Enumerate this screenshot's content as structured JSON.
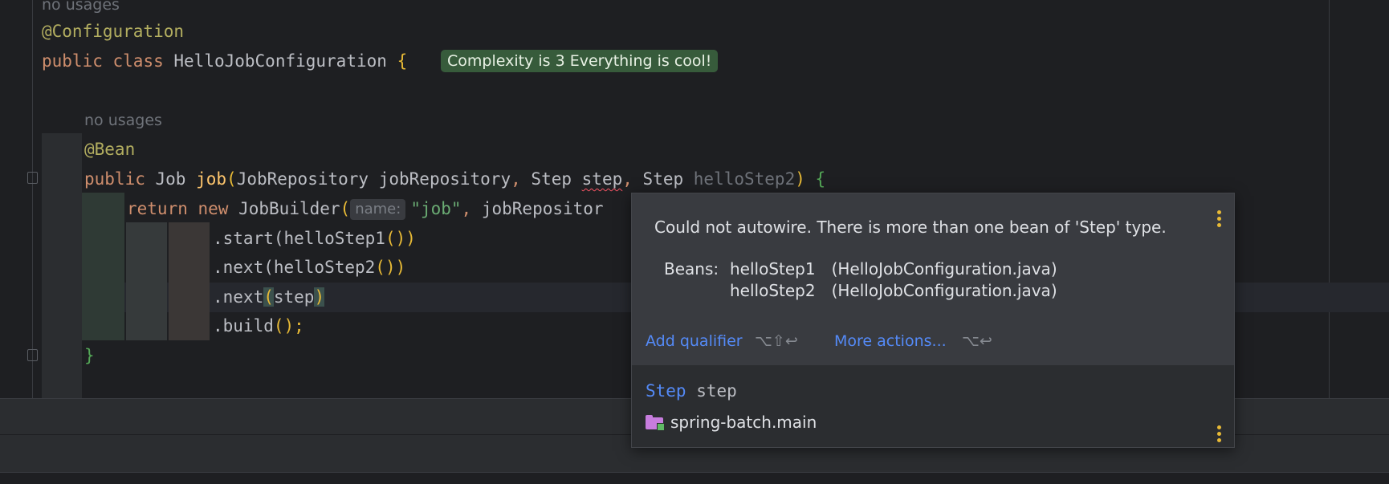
{
  "editor": {
    "lines": {
      "usage_top": "no usages",
      "annotation_config": "@Configuration",
      "class_kw1": "public",
      "class_kw2": "class",
      "class_name": "HelloJobConfiguration",
      "class_brace": "{",
      "usage_method": "no usages",
      "annotation_bean": "@Bean",
      "m_public": "public",
      "m_type": "Job",
      "m_name": "job",
      "m_paren_open": "(",
      "m_p1_type": "JobRepository",
      "m_p1_name": "jobRepository",
      "m_comma1": ",",
      "m_p2_type": "Step",
      "m_p2_name": "step",
      "m_comma2": ",",
      "m_p3_type": "Step",
      "m_p3_name": "helloStep2",
      "m_paren_close": ")",
      "m_brace": "{",
      "r_return": "return",
      "r_new": "new",
      "r_builder": "JobBuilder",
      "r_paren": "(",
      "r_hint": "name:",
      "r_str": "\"job\"",
      "r_comma": ",",
      "r_repo": "jobRepositor",
      "c_start": ".start(",
      "c_start_arg": "helloStep1",
      "c_start_tail": "())",
      "c_next1": ".next(",
      "c_next1_arg": "helloStep2",
      "c_next1_tail": "())",
      "c_next2": ".next",
      "c_next2_open": "(",
      "c_next2_arg": "step",
      "c_next2_close": ")",
      "c_build": ".build",
      "c_build_tail": "();",
      "close_brace": "}"
    },
    "complexity_badge": "Complexity is 3 Everything is cool!",
    "colors": {
      "background": "#1e1f22",
      "keyword": "#cf8e6d",
      "annotation": "#b3ae60",
      "string": "#6aab73",
      "badge_bg": "#375b3b",
      "link": "#548af7"
    }
  },
  "popup": {
    "message": "Could not autowire. There is more than one bean of 'Step' type.",
    "beans_label": "Beans:",
    "beans": [
      {
        "name": "helloStep1",
        "file": "(HelloJobConfiguration.java)"
      },
      {
        "name": "helloStep2",
        "file": "(HelloJobConfiguration.java)"
      }
    ],
    "actions": {
      "add_qualifier": "Add qualifier",
      "add_qualifier_shortcut": "⌥⇧↩",
      "more_actions": "More actions...",
      "more_actions_shortcut": "⌥↩"
    },
    "declaration": {
      "type": "Step",
      "name": "step"
    },
    "module": "spring-batch.main",
    "icons": {
      "menu": "kebab-menu-icon",
      "module": "module-folder-icon"
    }
  }
}
